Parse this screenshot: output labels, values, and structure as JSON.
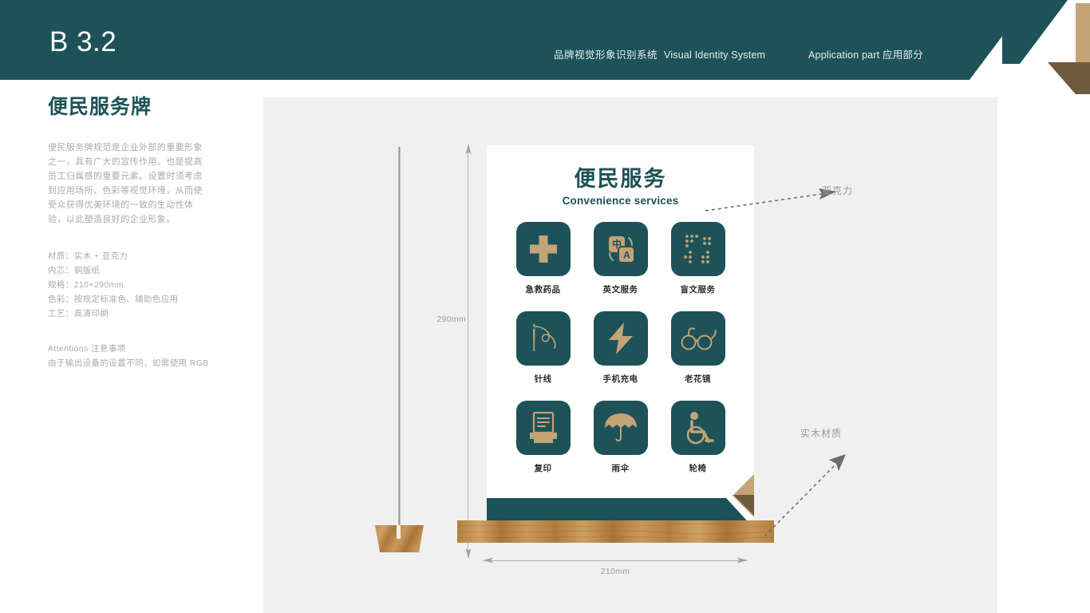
{
  "header": {
    "code": "B 3.2",
    "system_cn": "品牌视觉形象识别系统",
    "system_en": "Visual Identity System",
    "part": "Application part  应用部分",
    "bg_color": "#1d5358",
    "accent_color": "#c4a377"
  },
  "sidebar": {
    "title": "便民服务牌",
    "description": "便民服务牌规范是企业外部的重要形象之一，具有广大的宣传作用。也是提高员工归属感的重要元素。设置时须考虑到应用场所、色彩等视觉环境，从而使受众获得优美环境的一致的生动性体验，以此塑造良好的企业形象。",
    "specs": [
      "材质：实木 + 亚克力",
      "内芯：铜版纸",
      "规格：210×290mm",
      "色彩：按规定标准色、辅助色应用",
      "工艺：高清印刷"
    ],
    "attentions_title": "Attentions 注意事项",
    "attentions_text": "由于输出设备的设置不同，如需使用 RGB"
  },
  "mockup": {
    "card_title": "便民服务",
    "card_subtitle": "Convenience services",
    "services": [
      {
        "label": "急救药品",
        "icon": "first-aid-cross-icon"
      },
      {
        "label": "英文服务",
        "icon": "translate-icon"
      },
      {
        "label": "盲文服务",
        "icon": "braille-icon"
      },
      {
        "label": "针线",
        "icon": "needle-thread-icon"
      },
      {
        "label": "手机充电",
        "icon": "lightning-bolt-icon"
      },
      {
        "label": "老花镜",
        "icon": "eyeglasses-icon"
      },
      {
        "label": "复印",
        "icon": "printer-icon"
      },
      {
        "label": "雨伞",
        "icon": "umbrella-icon"
      },
      {
        "label": "轮椅",
        "icon": "wheelchair-icon"
      }
    ],
    "dimension_height": "290mm",
    "dimension_width": "210mm",
    "callout_acrylic": "亚克力",
    "callout_wood": "实木材质",
    "tile_color": "#1d5358",
    "icon_color": "#c4a377",
    "wood_color": "#b0793c",
    "stage_bg": "#f0f0f0"
  }
}
